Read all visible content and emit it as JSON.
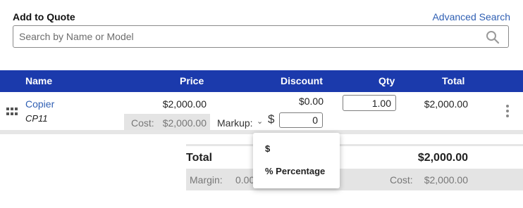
{
  "panel": {
    "title": "Add to Quote",
    "advanced_search_label": "Advanced Search"
  },
  "search": {
    "placeholder": "Search by Name or Model",
    "value": ""
  },
  "table": {
    "columns": {
      "name": "Name",
      "price": "Price",
      "discount": "Discount",
      "qty": "Qty",
      "total": "Total"
    },
    "rows": [
      {
        "name": "Copier",
        "model": "CP11",
        "price": "$2,000.00",
        "cost_label": "Cost:",
        "cost": "$2,000.00",
        "discount": "$0.00",
        "markup_label": "Markup:",
        "markup_unit": "$",
        "markup_value": "0",
        "qty": "1.00",
        "total": "$2,000.00"
      }
    ]
  },
  "summary": {
    "total_label": "Total",
    "total": "$2,000.00",
    "margin_label": "Margin:",
    "margin": "0.00",
    "cost_label": "Cost:",
    "cost": "$2,000.00"
  },
  "markup_dropdown": {
    "options": [
      "$",
      "% Percentage"
    ]
  },
  "colors": {
    "header_bg": "#1b3aac",
    "link": "#2f5fb3",
    "band_gray": "#e4e4e4"
  },
  "icons": {
    "search": "search-icon",
    "drag_handle": "drag-handle-icon",
    "more_actions": "kebab-menu-icon",
    "markup_caret": "chevron-down-icon"
  }
}
